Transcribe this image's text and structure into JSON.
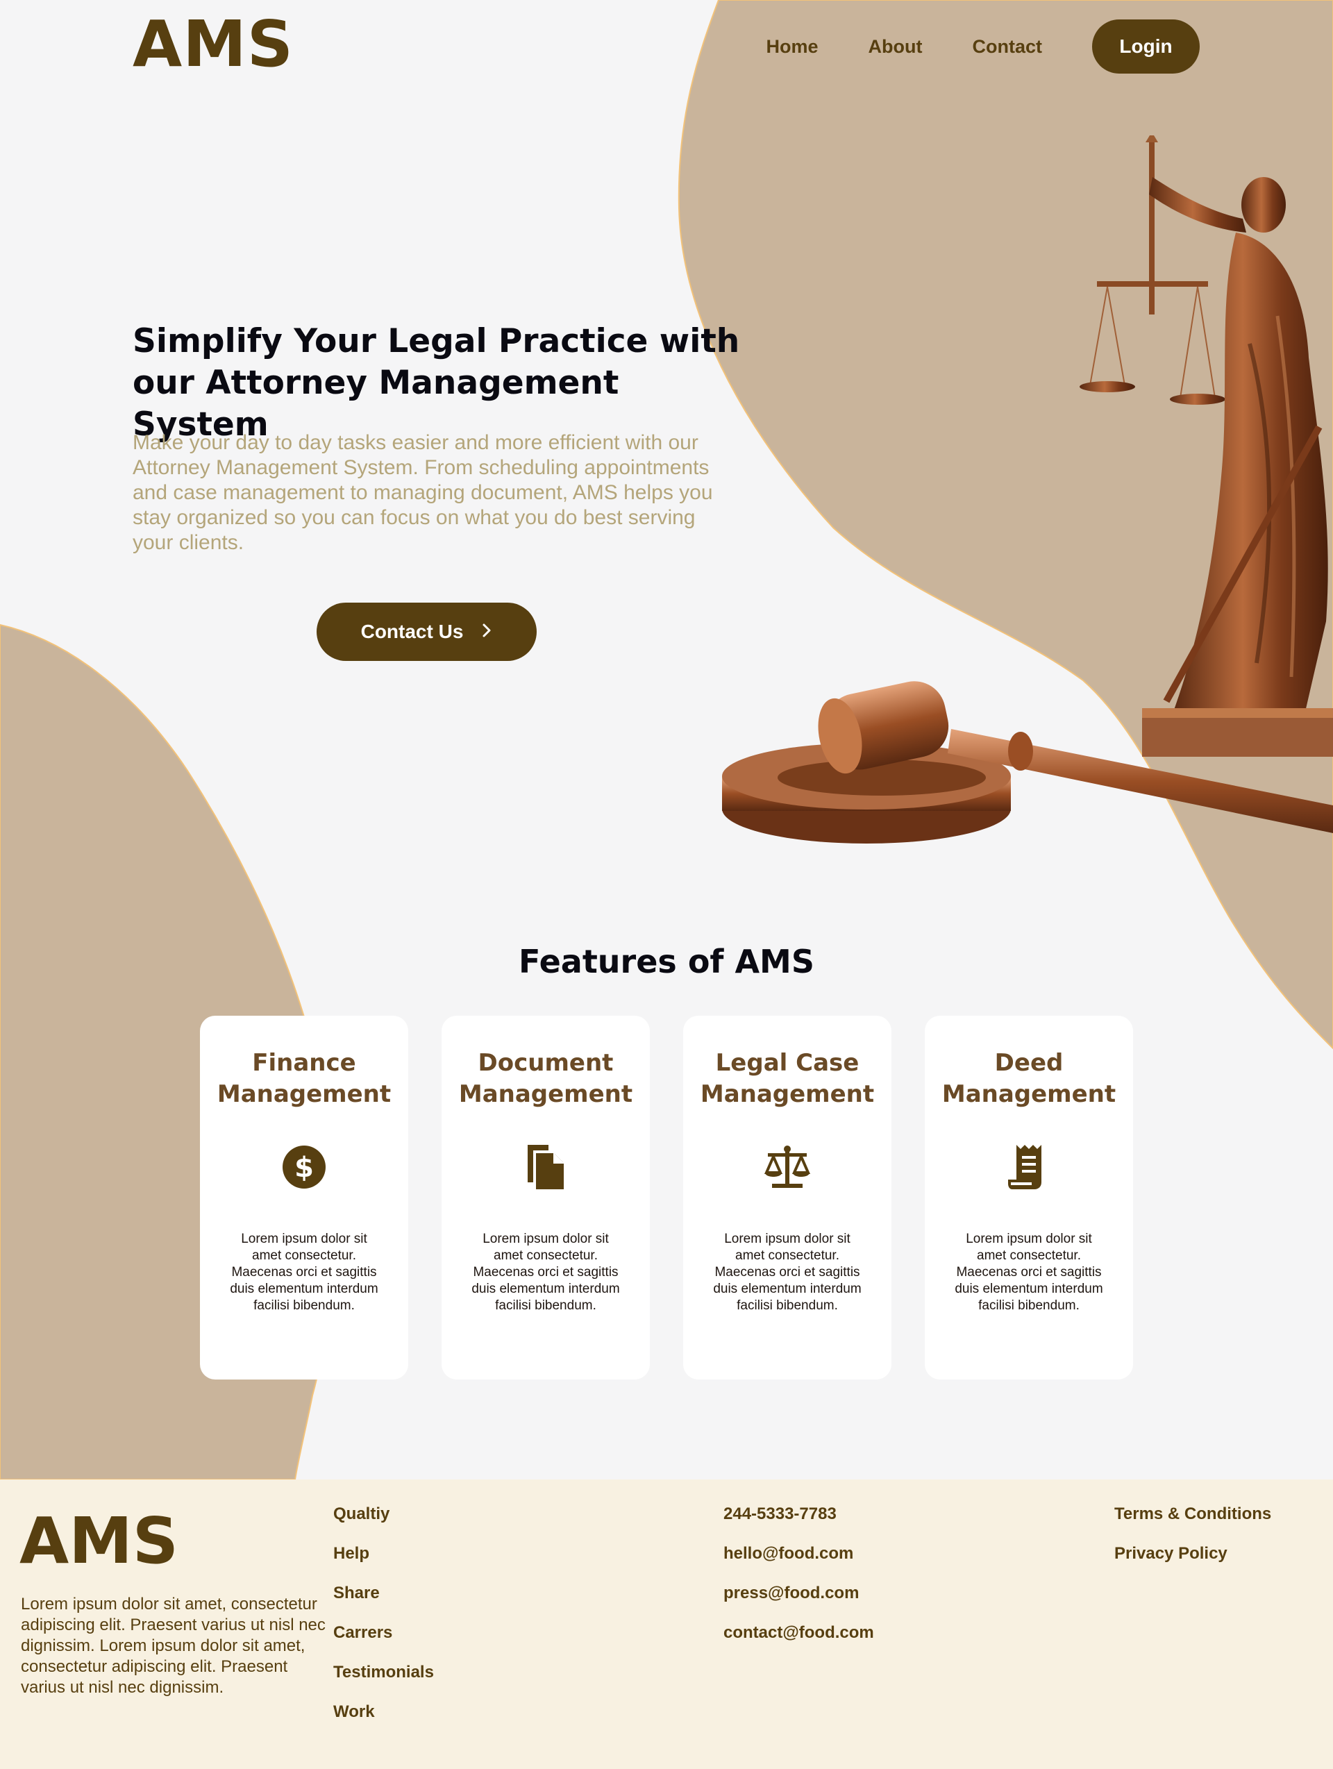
{
  "brand": {
    "logo": "AMS",
    "color": "#573f10",
    "accent_tan": "#c9b49b",
    "footer_bg": "#f8f1e1"
  },
  "nav": {
    "links": [
      "Home",
      "About",
      "Contact"
    ],
    "login_label": "Login"
  },
  "hero": {
    "title": "Simplify Your Legal Practice with our Attorney Management System",
    "subtitle": "Make your day to day tasks easier and more efficient with our Attorney Management System. From scheduling appointments and case management to managing document, AMS helps you stay organized so you can focus on what you do best serving your clients.",
    "cta_label": "Contact Us",
    "cta_icon": "chevron-right-icon",
    "images": [
      "lady-justice-statue",
      "gavel"
    ]
  },
  "features": {
    "title": "Features of AMS",
    "cards": [
      {
        "title": "Finance Management",
        "icon": "dollar-circle-icon",
        "text": "Lorem ipsum dolor sit amet consectetur. Maecenas orci et sagittis duis elementum interdum facilisi bibendum."
      },
      {
        "title": "Document Management",
        "icon": "documents-icon",
        "text": "Lorem ipsum dolor sit amet consectetur. Maecenas orci et sagittis duis elementum interdum facilisi bibendum."
      },
      {
        "title": "Legal Case Management",
        "icon": "scales-icon",
        "text": "Lorem ipsum dolor sit amet consectetur. Maecenas orci et sagittis duis elementum interdum facilisi bibendum."
      },
      {
        "title": "Deed Management",
        "icon": "receipt-icon",
        "text": "Lorem ipsum dolor sit amet consectetur. Maecenas orci et sagittis duis elementum interdum facilisi bibendum."
      }
    ]
  },
  "footer": {
    "logo": "AMS",
    "description": "Lorem ipsum dolor sit amet, consectetur adipiscing elit. Praesent varius ut nisl nec dignissim. Lorem ipsum dolor sit amet, consectetur adipiscing elit. Praesent varius ut nisl nec dignissim.",
    "links": [
      "Qualtiy",
      "Help",
      "Share",
      "Carrers",
      "Testimonials",
      "Work"
    ],
    "contacts": [
      "244-5333-7783",
      "hello@food.com",
      "press@food.com",
      "contact@food.com"
    ],
    "legal": [
      "Terms & Conditions",
      "Privacy Policy"
    ]
  }
}
